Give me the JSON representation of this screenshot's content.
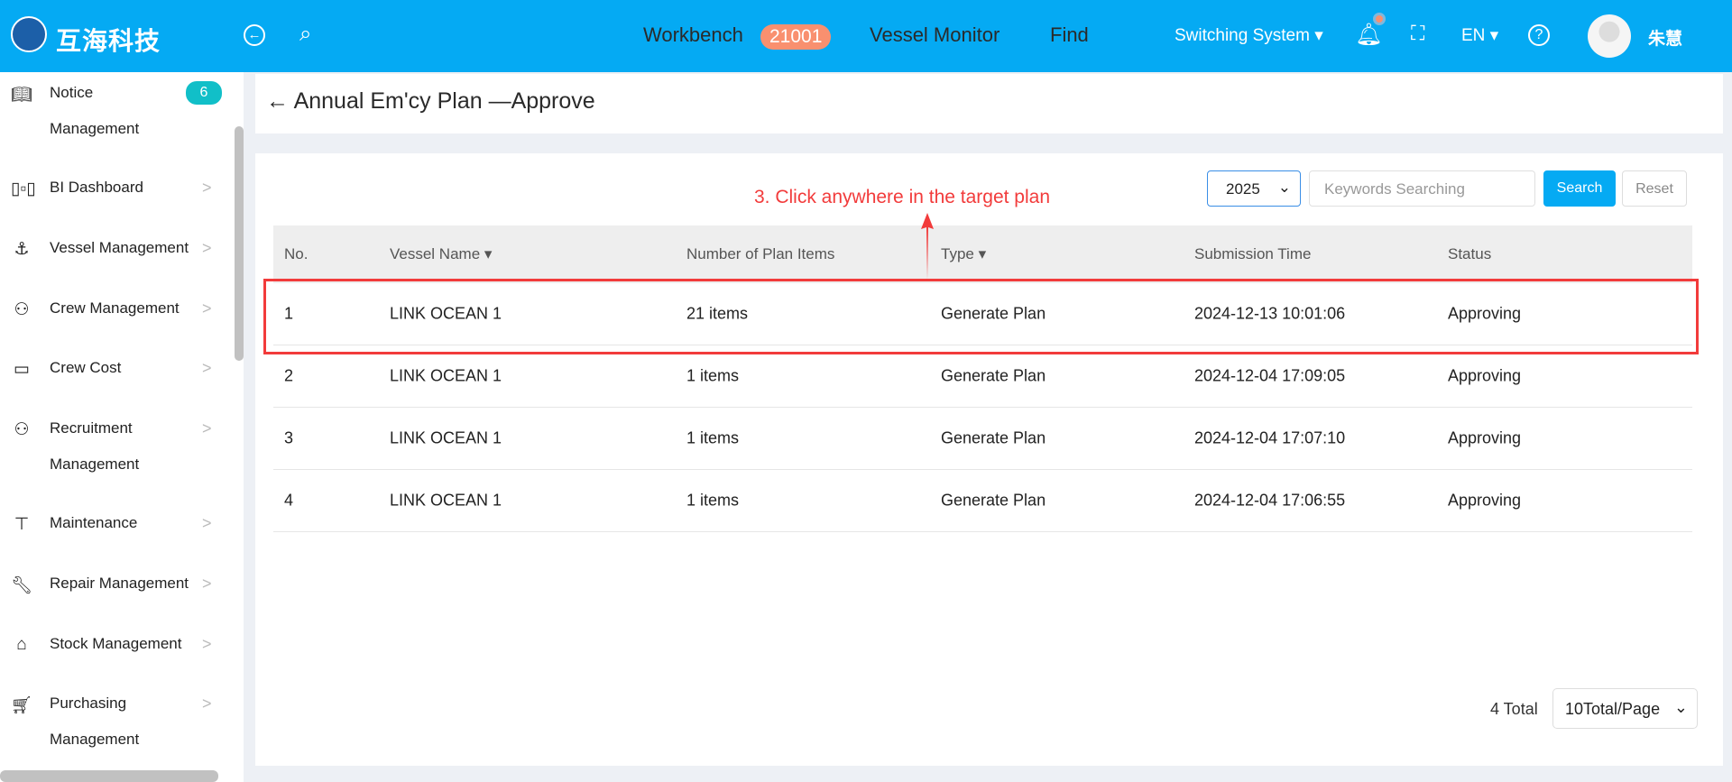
{
  "header": {
    "brand": "互海科技",
    "nav": [
      {
        "label": "Workbench",
        "badge": "21001"
      },
      {
        "label": "Vessel Monitor"
      },
      {
        "label": "Find"
      }
    ],
    "switch_system": "Switching System",
    "language": "EN",
    "user": "朱慧",
    "accent": "#05aaf3"
  },
  "sidebar": {
    "items": [
      {
        "label": "Notice",
        "label2": "Management",
        "icon": "book-icon",
        "badge": "6"
      },
      {
        "label": "BI Dashboard",
        "icon": "bar-chart-icon"
      },
      {
        "label": "Vessel Management",
        "icon": "anchor-icon"
      },
      {
        "label": "Crew Management",
        "icon": "user-icon"
      },
      {
        "label": "Crew Cost",
        "icon": "wallet-icon"
      },
      {
        "label": "Recruitment",
        "label2": "Management",
        "icon": "user-add-icon"
      },
      {
        "label": "Maintenance",
        "icon": "hammer-icon"
      },
      {
        "label": "Repair Management",
        "icon": "wrench-icon"
      },
      {
        "label": "Stock Management",
        "icon": "warehouse-icon"
      },
      {
        "label": "Purchasing",
        "label2": "Management",
        "icon": "cart-icon"
      }
    ]
  },
  "page": {
    "title": "Annual Em'cy Plan —Approve"
  },
  "filters": {
    "year": "2025",
    "search_placeholder": "Keywords Searching",
    "search_label": "Search",
    "reset_label": "Reset"
  },
  "annotation": "3. Click anywhere in the target plan",
  "table": {
    "columns": [
      "No.",
      "Vessel Name",
      "Number of Plan Items",
      "Type",
      "Submission Time",
      "Status"
    ],
    "rows": [
      [
        "1",
        "LINK OCEAN 1",
        "21 items",
        "Generate Plan",
        "2024-12-13 10:01:06",
        "Approving"
      ],
      [
        "2",
        "LINK OCEAN 1",
        "1 items",
        "Generate Plan",
        "2024-12-04 17:09:05",
        "Approving"
      ],
      [
        "3",
        "LINK OCEAN 1",
        "1 items",
        "Generate Plan",
        "2024-12-04 17:07:10",
        "Approving"
      ],
      [
        "4",
        "LINK OCEAN 1",
        "1 items",
        "Generate Plan",
        "2024-12-04 17:06:55",
        "Approving"
      ]
    ]
  },
  "pagination": {
    "total": "4 Total",
    "page_size": "10Total/Page"
  }
}
